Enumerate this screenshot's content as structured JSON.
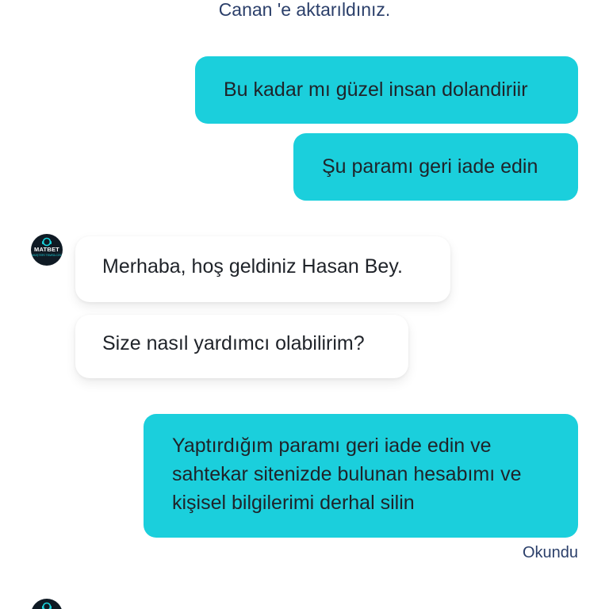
{
  "system_message": "Canan 'e aktarıldınız.",
  "avatar": {
    "brand": "MATBET",
    "subtitle": "MÜŞTERİ TEMSİLCİSİ"
  },
  "messages": [
    {
      "direction": "outgoing",
      "text": "Bu kadar mı güzel insan dolandiriir"
    },
    {
      "direction": "outgoing",
      "text": "Şu paramı geri iade edin"
    },
    {
      "direction": "incoming",
      "text": "Merhaba, hoş geldiniz Hasan Bey."
    },
    {
      "direction": "incoming",
      "text": "Size nasıl yardımcı olabilirim?"
    },
    {
      "direction": "outgoing",
      "text": "Yaptırdığım paramı geri iade edin ve sahtekar sitenizde bulunan hesabımı ve kişisel bilgilerimi derhal silin"
    }
  ],
  "read_status": "Okundu",
  "colors": {
    "outgoing_bubble": "#1bcfdc",
    "incoming_bubble": "#ffffff",
    "status_text": "#2b3f6a",
    "avatar_bg": "#0f1a24"
  }
}
